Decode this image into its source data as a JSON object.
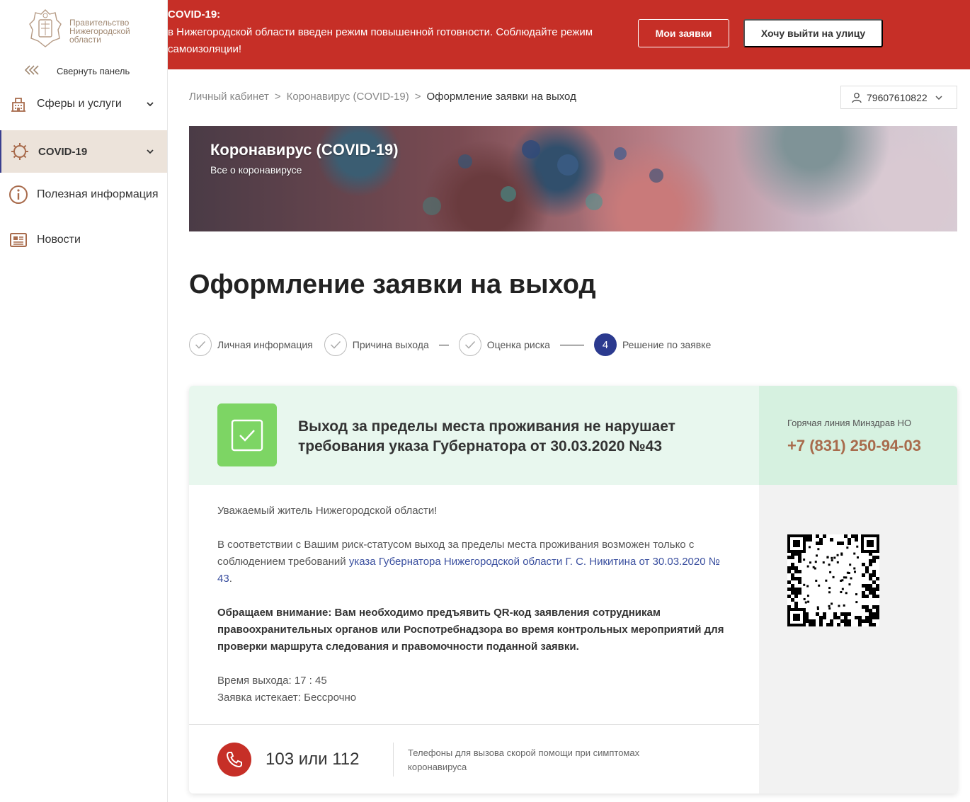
{
  "sidebar": {
    "logo_text": [
      "Правительство",
      "Нижегородской",
      "области"
    ],
    "collapse_label": "Свернуть панель",
    "items": [
      {
        "label": "Сферы и услуги",
        "icon": "building-icon",
        "active": false,
        "has_arrow": true
      },
      {
        "label": "COVID-19",
        "icon": "virus-icon",
        "active": true,
        "has_arrow": true
      },
      {
        "label": "Полезная информация",
        "icon": "info-icon",
        "active": false,
        "has_arrow": false
      },
      {
        "label": "Новости",
        "icon": "news-icon",
        "active": false,
        "has_arrow": false
      }
    ]
  },
  "banner": {
    "title": "COVID-19:",
    "text": "в Нижегородской области введен режим повышенной готовности. Соблюдайте режим самоизоляции!",
    "my_requests_button": "Мои заявки",
    "go_out_button": "Хочу выйти на улицу",
    "color": "#c62f27"
  },
  "breadcrumb": {
    "items": [
      "Личный кабинет",
      "Коронавирус (COVID-19)",
      "Оформление заявки на выход"
    ],
    "separator": ">"
  },
  "user": {
    "phone": "79607610822"
  },
  "hero": {
    "title": "Коронавирус (COVID-19)",
    "subtitle": "Все о коронавирусе"
  },
  "page_title": "Оформление заявки на выход",
  "stepper": {
    "steps": [
      {
        "label": "Личная информация",
        "done": true
      },
      {
        "label": "Причина выхода",
        "done": true
      },
      {
        "label": "Оценка риска",
        "done": true
      },
      {
        "label": "Решение по заявке",
        "done": false,
        "number": "4"
      }
    ]
  },
  "result": {
    "headline": "Выход за пределы места проживания не нарушает требования указа Губернатора от 30.03.2020 №43",
    "hotline_label": "Горячая линия Минздрав НО",
    "hotline_phone": "+7 (831) 250-94-03",
    "greeting": "Уважаемый житель Нижегородской области!",
    "para_prefix": "В соответствии с Вашим риск-статусом выход за пределы места проживания возможен только с соблюдением требований ",
    "para_link": "указа Губернатора Нижегородской области Г. С. Никитина от 30.03.2020 № 43",
    "para_suffix": ".",
    "attention": "Обращаем внимание: Вам необходимо предъявить QR-код заявления сотрудникам правоохранительных органов или Роспотребнадзора во время контрольных мероприятий для проверки маршрута следования и правомочности поданной заявки.",
    "exit_time": "Время выхода: 17 : 45",
    "expires": "Заявка истекает: Бессрочно",
    "emergency_numbers": "103 или 112",
    "emergency_note": "Телефоны для вызова скорой помощи при симптомах коронавируса"
  },
  "colors": {
    "accent_brown": "#a86b4c",
    "stepper_active": "#2b3a8f",
    "success_green": "#7dd564"
  }
}
